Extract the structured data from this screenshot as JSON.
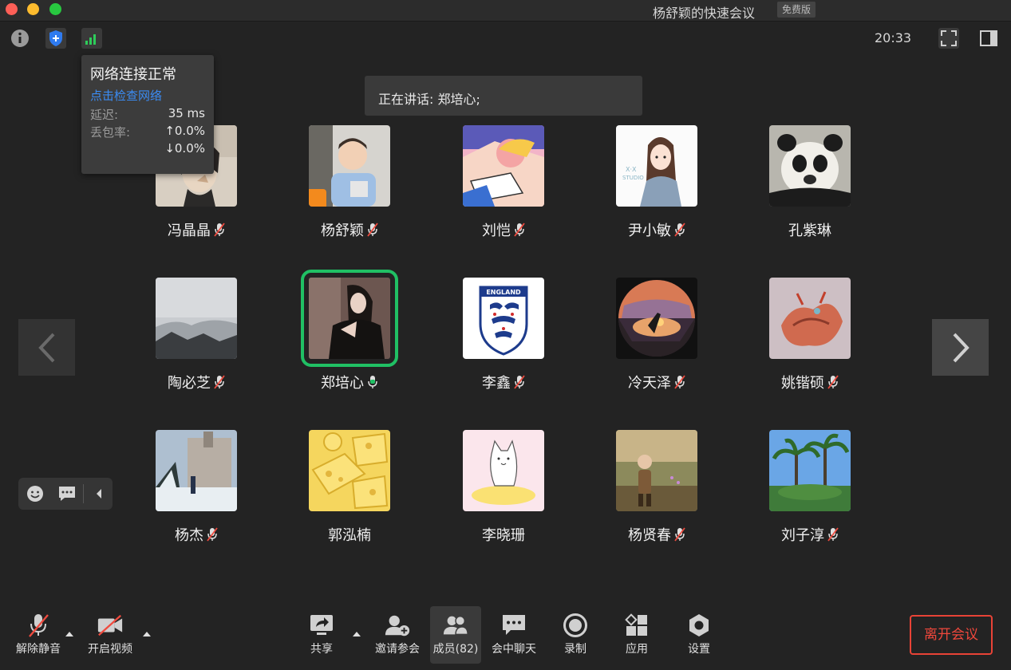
{
  "window": {
    "title": "杨舒颖的快速会议",
    "badge": "免费版"
  },
  "topbar": {
    "time": "20:33"
  },
  "network_popup": {
    "status": "网络连接正常",
    "check_link": "点击检查网络",
    "latency_label": "延迟:",
    "latency_value": "35 ms",
    "loss_label": "丢包率:",
    "loss_up": "↑0.0%",
    "loss_down": "↓0.0%"
  },
  "speaking": "正在讲话: 郑培心;",
  "participants": [
    {
      "name": "冯晶晶",
      "mic": "muted"
    },
    {
      "name": "杨舒颖",
      "mic": "muted",
      "host": true
    },
    {
      "name": "刘恺",
      "mic": "muted"
    },
    {
      "name": "尹小敏",
      "mic": "muted"
    },
    {
      "name": "孔紫琳",
      "mic": "none"
    },
    {
      "name": "陶必芝",
      "mic": "muted"
    },
    {
      "name": "郑培心",
      "mic": "active",
      "speaking": true
    },
    {
      "name": "李鑫",
      "mic": "muted"
    },
    {
      "name": "冷天泽",
      "mic": "muted"
    },
    {
      "name": "姚锴硕",
      "mic": "muted"
    },
    {
      "name": "杨杰",
      "mic": "muted"
    },
    {
      "name": "郭泓楠",
      "mic": "none"
    },
    {
      "name": "李晓珊",
      "mic": "none"
    },
    {
      "name": "杨贤春",
      "mic": "muted"
    },
    {
      "name": "刘子淳",
      "mic": "muted"
    }
  ],
  "toolbar": {
    "unmute": "解除静音",
    "start_video": "开启视频",
    "share": "共享",
    "invite": "邀请参会",
    "members": "成员(82)",
    "chat": "会中聊天",
    "record": "录制",
    "apps": "应用",
    "settings": "设置",
    "leave": "离开会议"
  },
  "colors": {
    "accent_green": "#20c064",
    "leave_red": "#e84336",
    "link_blue": "#3b8cf3",
    "host_orange": "#f38a1d"
  }
}
